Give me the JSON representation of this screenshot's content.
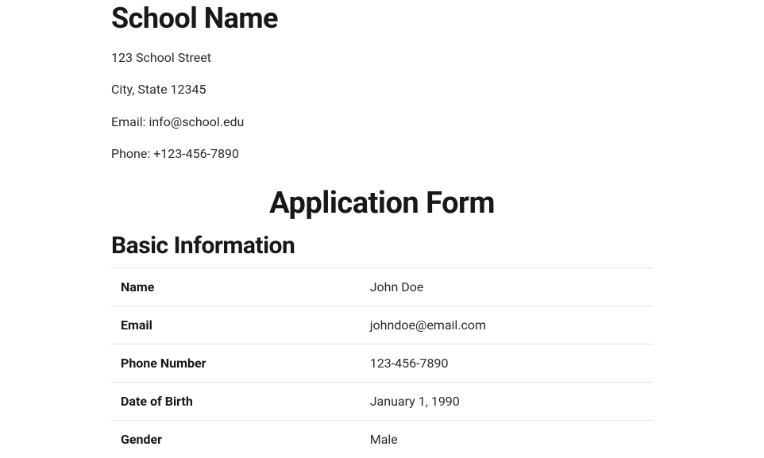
{
  "header": {
    "school_name": "School Name",
    "address_line1": "123 School Street",
    "address_line2": "City, State 12345",
    "email_line": "Email: info@school.edu",
    "phone_line": "Phone: +123-456-7890"
  },
  "form": {
    "title": "Application Form",
    "section_title": "Basic Information",
    "rows": [
      {
        "label": "Name",
        "value": "John Doe"
      },
      {
        "label": "Email",
        "value": "johndoe@email.com"
      },
      {
        "label": "Phone Number",
        "value": "123-456-7890"
      },
      {
        "label": "Date of Birth",
        "value": "January 1, 1990"
      },
      {
        "label": "Gender",
        "value": "Male"
      }
    ]
  }
}
